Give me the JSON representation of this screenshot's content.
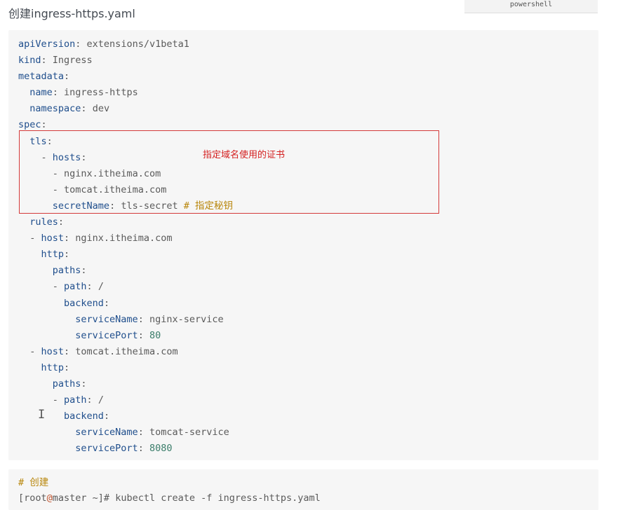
{
  "title": "创建ingress-https.yaml",
  "lang_tab": "powershell",
  "code_lines": [
    {
      "key": "apiVersion",
      "sep": ": ",
      "value": "extensions/v1beta1",
      "vclass": "s",
      "comment": ""
    },
    {
      "key": "kind",
      "sep": ": ",
      "value": "Ingress",
      "vclass": "s",
      "comment": ""
    },
    {
      "key": "metadata",
      "sep": ":",
      "value": "",
      "vclass": "s",
      "comment": ""
    },
    {
      "indent": "  ",
      "key": "name",
      "sep": ": ",
      "value": "ingress-https",
      "vclass": "s",
      "comment": ""
    },
    {
      "indent": "  ",
      "key": "namespace",
      "sep": ": ",
      "value": "dev",
      "vclass": "s",
      "comment": ""
    },
    {
      "key": "spec",
      "sep": ":",
      "value": "",
      "vclass": "s",
      "comment": ""
    },
    {
      "indent": "  ",
      "key": "tls",
      "sep": ":",
      "value": "",
      "vclass": "s",
      "comment": ""
    },
    {
      "indent": "    - ",
      "key": "hosts",
      "sep": ":",
      "value": "",
      "vclass": "s",
      "comment": ""
    },
    {
      "indent": "      - ",
      "key": "",
      "sep": "",
      "value": "nginx.itheima.com",
      "vclass": "s",
      "comment": ""
    },
    {
      "indent": "      - ",
      "key": "",
      "sep": "",
      "value": "tomcat.itheima.com",
      "vclass": "s",
      "comment": ""
    },
    {
      "indent": "      ",
      "key": "secretName",
      "sep": ": ",
      "value": "tls-secret ",
      "vclass": "s",
      "comment": "# 指定秘钥"
    },
    {
      "indent": "  ",
      "key": "rules",
      "sep": ":",
      "value": "",
      "vclass": "s",
      "comment": ""
    },
    {
      "indent": "  - ",
      "key": "host",
      "sep": ": ",
      "value": "nginx.itheima.com",
      "vclass": "s",
      "comment": ""
    },
    {
      "indent": "    ",
      "key": "http",
      "sep": ":",
      "value": "",
      "vclass": "s",
      "comment": ""
    },
    {
      "indent": "      ",
      "key": "paths",
      "sep": ":",
      "value": "",
      "vclass": "s",
      "comment": ""
    },
    {
      "indent": "      - ",
      "key": "path",
      "sep": ": ",
      "value": "/",
      "vclass": "s",
      "comment": ""
    },
    {
      "indent": "        ",
      "key": "backend",
      "sep": ":",
      "value": "",
      "vclass": "s",
      "comment": ""
    },
    {
      "indent": "          ",
      "key": "serviceName",
      "sep": ": ",
      "value": "nginx-service",
      "vclass": "s",
      "comment": ""
    },
    {
      "indent": "          ",
      "key": "servicePort",
      "sep": ": ",
      "value": "80",
      "vclass": "n",
      "comment": ""
    },
    {
      "indent": "  - ",
      "key": "host",
      "sep": ": ",
      "value": "tomcat.itheima.com",
      "vclass": "s",
      "comment": ""
    },
    {
      "indent": "    ",
      "key": "http",
      "sep": ":",
      "value": "",
      "vclass": "s",
      "comment": ""
    },
    {
      "indent": "      ",
      "key": "paths",
      "sep": ":",
      "value": "",
      "vclass": "s",
      "comment": ""
    },
    {
      "indent": "      - ",
      "key": "path",
      "sep": ": ",
      "value": "/",
      "vclass": "s",
      "comment": ""
    },
    {
      "indent": "        ",
      "key": "backend",
      "sep": ":",
      "value": "",
      "vclass": "s",
      "comment": ""
    },
    {
      "indent": "          ",
      "key": "serviceName",
      "sep": ": ",
      "value": "tomcat-service",
      "vclass": "s",
      "comment": ""
    },
    {
      "indent": "          ",
      "key": "servicePort",
      "sep": ": ",
      "value": "8080",
      "vclass": "n",
      "comment": ""
    }
  ],
  "annotation": "指定域名使用的证书",
  "cursor_glyph": "I",
  "command": {
    "comment": "# 创建",
    "prompt_user": "[root",
    "prompt_at": "@",
    "prompt_host": "master ~]# ",
    "text": "kubectl create -f ingress-https.yaml"
  },
  "colors": {
    "key": "#1f4e8c",
    "number": "#3a7d6a",
    "comment": "#b8860b",
    "highlight_border": "#d43a3a",
    "annotation": "#d42020"
  }
}
